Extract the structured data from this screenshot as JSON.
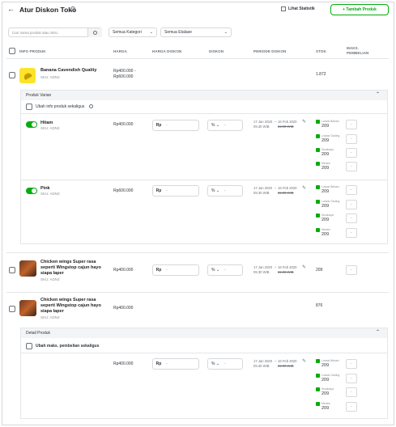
{
  "header": {
    "back_icon": "arrow-left-icon",
    "title": "Atur Diskon Toko",
    "info_icon": "info-circle-icon",
    "stats_label": "Lihat Statistik",
    "add_label": "+ Tambah Produk"
  },
  "filters": {
    "search_placeholder": "Cari nama produk atau SKU",
    "category": "Semua Kategori",
    "showcase": "Semua Etalase"
  },
  "table_headers": {
    "info": "INFO PRODUK",
    "price": "HARGA",
    "disc_price": "HARGA DISKON",
    "discount": "DISKON",
    "period": "PERIODE DISKON",
    "stock": "STOK",
    "max": "MAKS. PEMBELIAN"
  },
  "common": {
    "rp": "Rp",
    "pct": "% ",
    "dash": "-",
    "period_start": "17 Jan 2020",
    "period_start_time": "09.30 WIB",
    "period_end": "16 Feb 2020",
    "period_end_time": "22.00 WIB",
    "period_sep": "–",
    "edit_icon": "pencil-icon"
  },
  "warehouses": [
    "Lokasi Bekasi",
    "Lokasi Gading",
    "Surabaya",
    "Medan"
  ],
  "products": [
    {
      "name": "Banana Cavendish Quality",
      "sku": "SKU: ADN3",
      "price_line1": "Rp400.000 -",
      "price_line2": "Rp600.000",
      "stock": "1.872",
      "panel_title": "Produk Varian",
      "bulk_label": "Ubah info produk sekaligus",
      "variants": [
        {
          "name": "Hitam",
          "sku": "SKU: ADN3",
          "price": "Rp400.000",
          "stocks": [
            "209",
            "209",
            "209",
            "209"
          ]
        },
        {
          "name": "Pink",
          "sku": "SKU: ADN3",
          "price": "Rp600.000",
          "stocks": [
            "209",
            "209",
            "209",
            "209"
          ]
        }
      ]
    },
    {
      "name": "Chicken wings Super rasa seperti Wingstop cajun hayo siapa laper",
      "sku": "SKU: ADN3",
      "price": "Rp400.000",
      "stock": "209"
    },
    {
      "name": "Chicken wings Super rasa seperti Wingstop cajun hayo siapa laper",
      "sku": "SKU: ADN3",
      "price": "Rp400.000",
      "stock": "876",
      "panel_title": "Detail Produk",
      "bulk_label": "Ubah maks. pembelian sekaligus",
      "row_price": "Rp400.000",
      "stocks": [
        "209",
        "209",
        "209",
        "209"
      ]
    }
  ]
}
